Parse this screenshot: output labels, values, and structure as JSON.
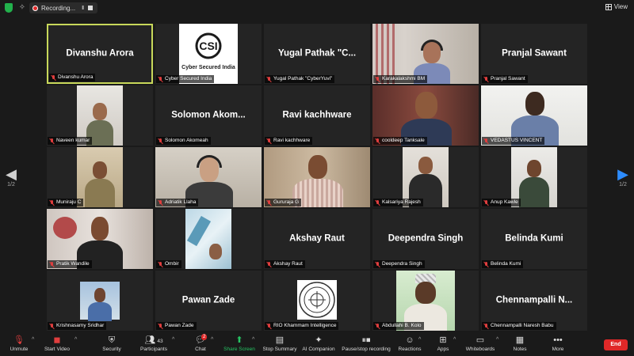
{
  "topbar": {
    "recording_label": "Recording...",
    "view_label": "View",
    "pause_glyph": "II"
  },
  "nav": {
    "page_left": "1/2",
    "page_right": "1/2"
  },
  "tiles": [
    {
      "display": "Divanshu Arora",
      "label": "Divanshu Arora"
    },
    {
      "display": "Cyber Secured India",
      "label": "Cyber Secured India"
    },
    {
      "display": "Yugal Pathak \"C...",
      "label": "Yugal Pathak \"CyberYuvi\""
    },
    {
      "display": "",
      "label": "Karakalakshmi BM"
    },
    {
      "display": "Pranjal Sawant",
      "label": "Pranjal Sawant"
    },
    {
      "display": "",
      "label": "Naveen kumar"
    },
    {
      "display": "Solomon Akom...",
      "label": "Solomon Akomeah"
    },
    {
      "display": "Ravi kachhware",
      "label": "Ravi kachhware"
    },
    {
      "display": "",
      "label": "cooldeep Tanksale"
    },
    {
      "display": "",
      "label": "VEDASTUS VINCENT"
    },
    {
      "display": "",
      "label": "Muniraju C"
    },
    {
      "display": "",
      "label": "Adriatik Llaha"
    },
    {
      "display": "",
      "label": "Gururaja G"
    },
    {
      "display": "",
      "label": "Kalsariya Rajesh"
    },
    {
      "display": "",
      "label": "Anup Kawle"
    },
    {
      "display": "",
      "label": "Pratik Wandile"
    },
    {
      "display": "",
      "label": "Ombir"
    },
    {
      "display": "Akshay Raut",
      "label": "Akshay Raut"
    },
    {
      "display": "Deependra Singh",
      "label": "Deependra Singh"
    },
    {
      "display": "Belinda Kumi",
      "label": "Belinda Kumi"
    },
    {
      "display": "",
      "label": "Krishnasamy Sridhar"
    },
    {
      "display": "Pawan Zade",
      "label": "Pawan Zade"
    },
    {
      "display": "",
      "label": "RIO Khammam Intelligence"
    },
    {
      "display": "",
      "label": "Abdullahi B. Kolo"
    },
    {
      "display": "Chennampalli N...",
      "label": "Chennampalli Naresh Babu"
    }
  ],
  "logo": {
    "letters": "CSI",
    "text": "Cyber Secured India"
  },
  "toolbar": {
    "unmute": "Unmute",
    "start_video": "Start Video",
    "security": "Security",
    "participants": "Participants",
    "participants_count": "43",
    "chat": "Chat",
    "chat_badge": "2",
    "share_screen": "Share Screen",
    "stop_summary": "Stop Summary",
    "ai_companion": "AI Companion",
    "pause_recording": "Pause/stop recording",
    "reactions": "Reactions",
    "apps": "Apps",
    "whiteboards": "Whiteboards",
    "notes": "Notes",
    "more": "More",
    "end": "End"
  },
  "colors": {
    "accent_green": "#25c463",
    "end_red": "#e02828",
    "active_speaker": "#c8d85a",
    "nav_blue": "#2d8cff"
  }
}
